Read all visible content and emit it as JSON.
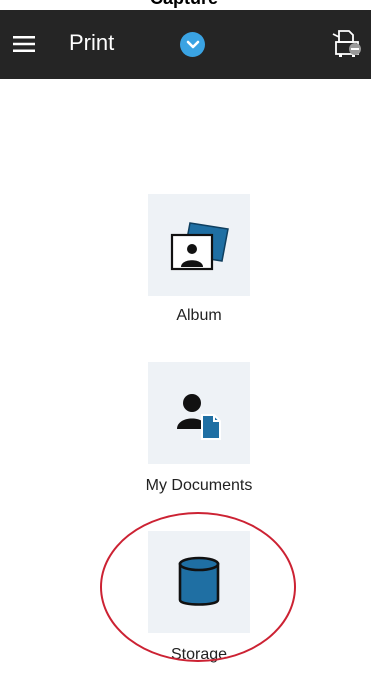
{
  "status": {
    "clipped_text": "Capture"
  },
  "toolbar": {
    "title": "Print",
    "menu_icon": "hamburger-menu-icon",
    "dropdown_icon": "chevron-down-icon",
    "printer_icon": "printer-icon",
    "background": "#252525",
    "accent": "#3aa3e3"
  },
  "items": [
    {
      "label": "Album",
      "icon": "photo-album-icon"
    },
    {
      "label": "My Documents",
      "icon": "user-document-icon"
    },
    {
      "label": "Storage",
      "icon": "storage-cylinder-icon"
    }
  ],
  "annotation": {
    "color": "#cc2233"
  }
}
